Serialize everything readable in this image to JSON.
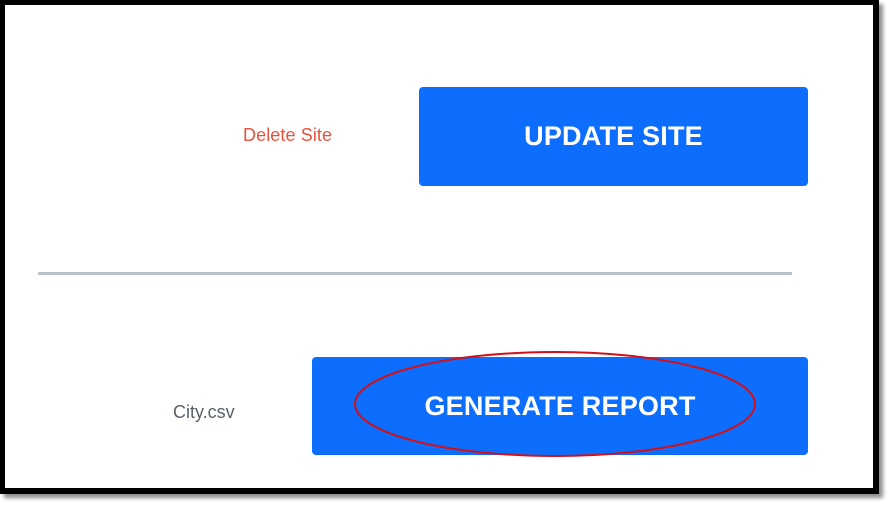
{
  "site_actions": {
    "delete_label": "Delete Site",
    "update_label": "UPDATE SITE"
  },
  "report": {
    "file_name": "City.csv",
    "generate_label": "GENERATE REPORT"
  },
  "colors": {
    "primary_button": "#0d6efd",
    "danger_link": "#e8533f",
    "divider": "#b9c1cb",
    "annotation": "#d0101a"
  }
}
